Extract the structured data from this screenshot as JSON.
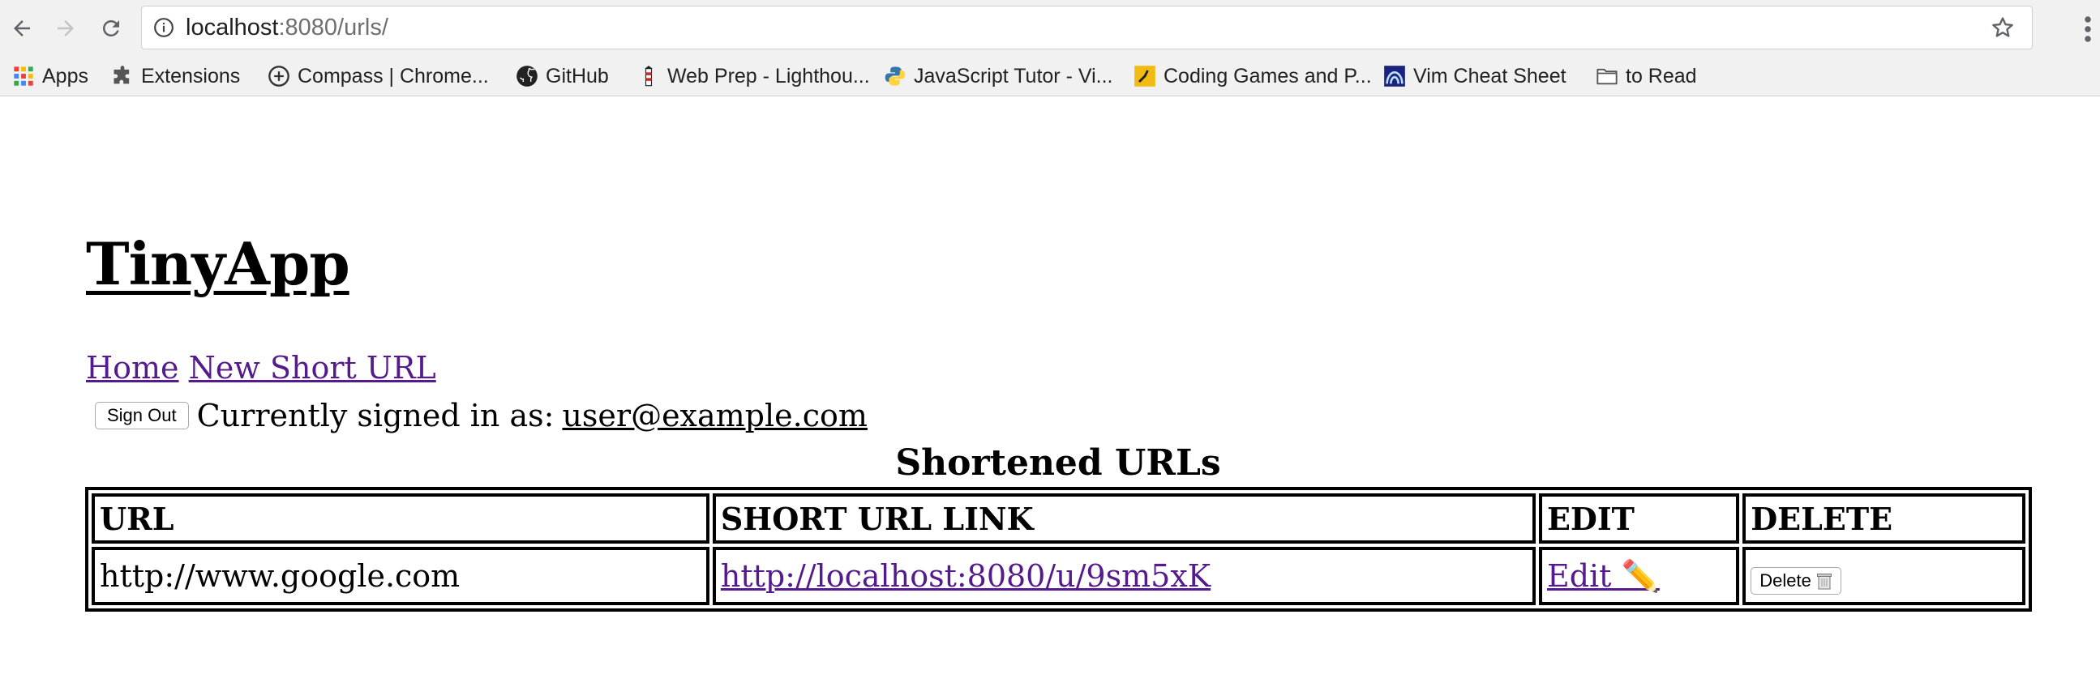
{
  "browser": {
    "url_host": "localhost",
    "url_rest": ":8080/urls/",
    "bookmarks": [
      {
        "label": "Apps",
        "icon": "apps-grid-icon"
      },
      {
        "label": "Extensions",
        "icon": "puzzle-icon"
      },
      {
        "label": "Compass | Chrome...",
        "icon": "compass-icon"
      },
      {
        "label": "GitHub",
        "icon": "github-icon"
      },
      {
        "label": "Web Prep - Lighthou...",
        "icon": "lighthouse-icon"
      },
      {
        "label": "JavaScript Tutor - Vi...",
        "icon": "python-icon"
      },
      {
        "label": "Coding Games and P...",
        "icon": "codingame-icon"
      },
      {
        "label": "Vim Cheat Sheet",
        "icon": "vim-icon"
      },
      {
        "label": "to Read",
        "icon": "folder-icon"
      }
    ]
  },
  "page": {
    "title": "TinyApp",
    "nav": {
      "home": "Home",
      "new_url": "New Short URL"
    },
    "auth": {
      "sign_out": "Sign Out",
      "signed_in_label": "Currently signed in as:",
      "email": "user@example.com"
    },
    "heading": "Shortened URLs",
    "table": {
      "headers": [
        "URL",
        "SHORT URL LINK",
        "EDIT",
        "DELETE"
      ],
      "rows": [
        {
          "url": "http://www.google.com",
          "short_link": "http://localhost:8080/u/9sm5xK",
          "edit_label": "Edit ✏️",
          "delete_label": "Delete"
        }
      ]
    }
  }
}
